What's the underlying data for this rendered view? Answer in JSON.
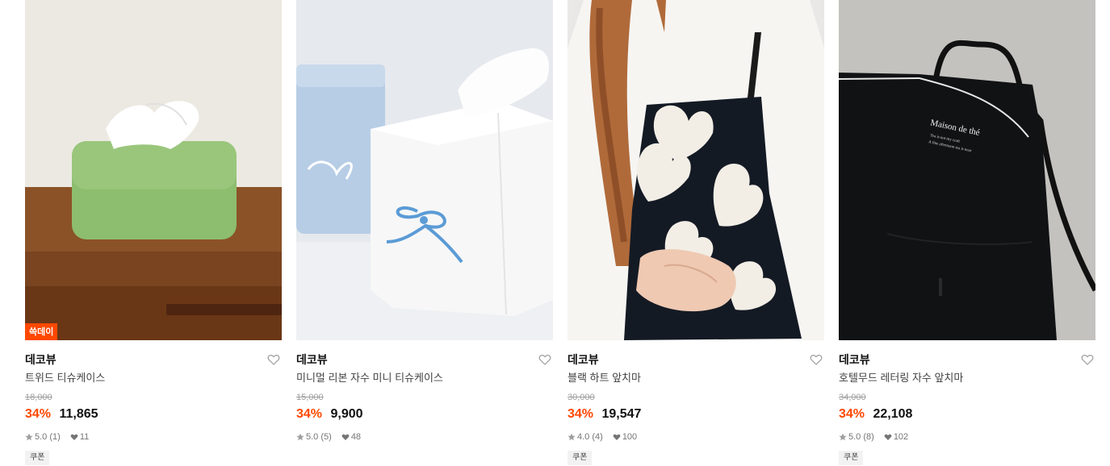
{
  "products": [
    {
      "badge": "쓱데이",
      "brand": "데코뷰",
      "title": "트위드 티슈케이스",
      "original_price": "18,000",
      "discount": "34%",
      "price": "11,865",
      "rating": "5.0",
      "reviews": "(1)",
      "likes": "11",
      "coupon": "쿠폰"
    },
    {
      "badge": "",
      "brand": "데코뷰",
      "title": "미니멀 리본 자수 미니 티슈케이스",
      "original_price": "15,000",
      "discount": "34%",
      "price": "9,900",
      "rating": "5.0",
      "reviews": "(5)",
      "likes": "48",
      "coupon": ""
    },
    {
      "badge": "",
      "brand": "데코뷰",
      "title": "블랙 하트 앞치마",
      "original_price": "30,000",
      "discount": "34%",
      "price": "19,547",
      "rating": "4.0",
      "reviews": "(4)",
      "likes": "100",
      "coupon": "쿠폰"
    },
    {
      "badge": "",
      "brand": "데코뷰",
      "title": "호텔무드 레터링 자수 앞치마",
      "original_price": "34,000",
      "discount": "34%",
      "price": "22,108",
      "rating": "5.0",
      "reviews": "(8)",
      "likes": "102",
      "coupon": "쿠폰"
    }
  ],
  "apron_lettering": [
    "Maison de thé",
    "Tea is not my craft",
    "A fine afternoon tea is near"
  ],
  "colors": {
    "accent": "#ff4800",
    "text": "#111111",
    "muted": "#9e9e9e"
  },
  "icons": {
    "wish": "heart-outline-icon",
    "rating": "star-icon",
    "likes": "heart-filled-icon"
  }
}
